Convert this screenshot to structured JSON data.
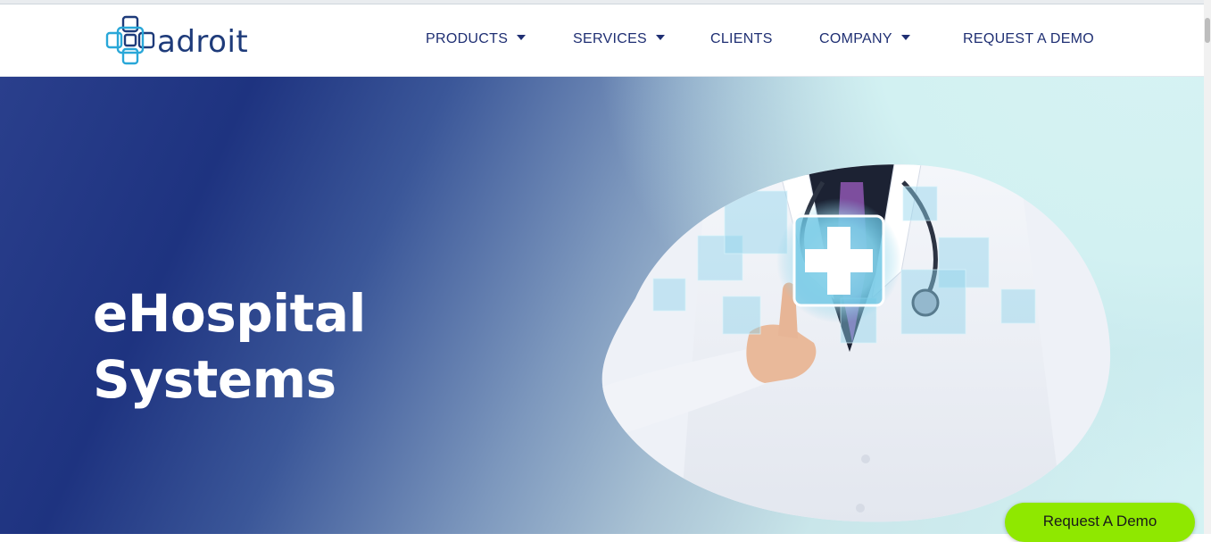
{
  "brand": {
    "name": "adroit"
  },
  "nav": {
    "items": [
      {
        "label": "PRODUCTS",
        "has_dropdown": true
      },
      {
        "label": "SERVICES",
        "has_dropdown": true
      },
      {
        "label": "CLIENTS",
        "has_dropdown": false
      },
      {
        "label": "COMPANY",
        "has_dropdown": true
      },
      {
        "label": "REQUEST A DEMO",
        "has_dropdown": false
      }
    ]
  },
  "hero": {
    "title_line1": "eHospital",
    "title_line2": "Systems",
    "image": "doctor-touching-medical-cross-icon"
  },
  "floating_cta": {
    "label": "Request A Demo"
  },
  "colors": {
    "brand_navy": "#1f2f73",
    "logo_blue": "#29a7d8",
    "cta_green": "#8fe800",
    "hero_dark": "#1e3380",
    "hero_light": "#d3f2f3"
  }
}
